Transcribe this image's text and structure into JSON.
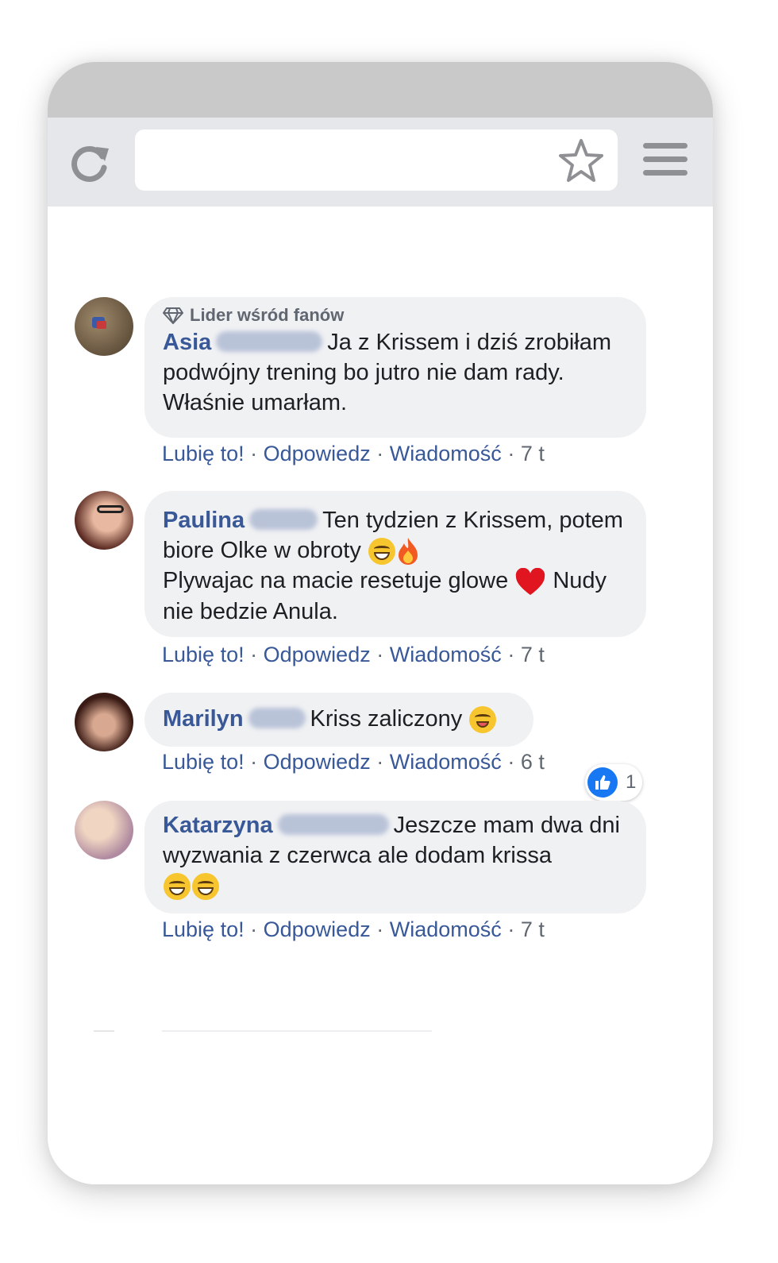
{
  "browser": {
    "reload_icon": "reload-icon",
    "bookmark_icon": "star-icon",
    "menu_icon": "hamburger-menu-icon"
  },
  "comments": [
    {
      "badge": "Lider wśród fanów",
      "first_name": "Asia",
      "text": "Ja z Krissem i dziś zrobiłam podwójny trening bo jutro nie dam rady. Właśnie umarłam.",
      "actions": {
        "like": "Lubię to!",
        "reply": "Odpowiedz",
        "message": "Wiadomość",
        "time": "7 t"
      }
    },
    {
      "first_name": "Paulina",
      "text_1": "Ten tydzien z Krissem, potem biore Olke w obroty",
      "text_2": "Plywajac na macie resetuje glowe",
      "text_3": "Nudy nie bedzie Anula.",
      "reaction_count": "1",
      "actions": {
        "like": "Lubię to!",
        "reply": "Odpowiedz",
        "message": "Wiadomość",
        "time": "7 t"
      }
    },
    {
      "first_name": "Marilyn",
      "text": "Kriss zaliczony",
      "actions": {
        "like": "Lubię to!",
        "reply": "Odpowiedz",
        "message": "Wiadomość",
        "time": "6 t"
      }
    },
    {
      "first_name": "Katarzyna",
      "text": "Jeszcze mam dwa dni wyzwania z czerwca ale dodam krissa",
      "actions": {
        "like": "Lubię to!",
        "reply": "Odpowiedz",
        "message": "Wiadomość",
        "time": "7 t"
      }
    }
  ],
  "separator": "·",
  "colors": {
    "name": "#385898",
    "bubble": "#f0f1f3",
    "like_blue": "#1877f2"
  }
}
